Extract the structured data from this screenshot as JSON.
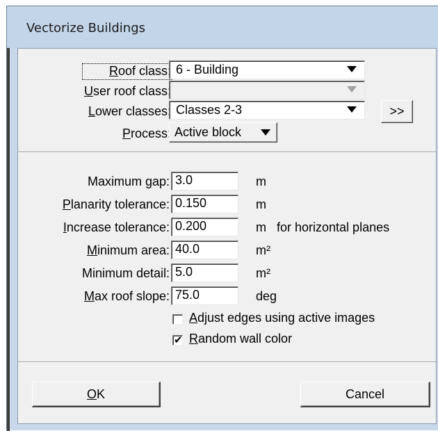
{
  "window": {
    "title": "Vectorize Buildings"
  },
  "classes": {
    "roof_class_label_pre": "",
    "roof_class_label_u": "R",
    "roof_class_label_post": "oof class:",
    "roof_class_value": "6 - Building",
    "user_roof_class_label_u": "U",
    "user_roof_class_label_post": "ser roof class:",
    "user_roof_class_value": "",
    "lower_classes_label_u": "L",
    "lower_classes_label_post": "ower classes:",
    "lower_classes_value": "Classes 2-3",
    "more_button": ">>",
    "process_label_u": "P",
    "process_label_post": "rocess:",
    "process_value": "Active block"
  },
  "params": {
    "max_gap_label": "Maximum gap:",
    "max_gap_value": "3.0",
    "max_gap_unit": "m",
    "planarity_label_u": "P",
    "planarity_label_post": "lanarity tolerance:",
    "planarity_value": "0.150",
    "planarity_unit": "m",
    "increase_label_u": "I",
    "increase_label_post": "ncrease tolerance:",
    "increase_value": "0.200",
    "increase_unit": "m",
    "increase_note": "for horizontal planes",
    "min_area_label_u": "M",
    "min_area_label_post": "inimum area:",
    "min_area_value": "40.0",
    "min_area_unit": "m²",
    "min_detail_label": "Minimum detail:",
    "min_detail_value": "5.0",
    "min_detail_unit": "m²",
    "max_slope_label_u": "M",
    "max_slope_label_post": "ax roof slope:",
    "max_slope_value": "75.0",
    "max_slope_unit": "deg"
  },
  "options": {
    "adjust_edges_label_u": "A",
    "adjust_edges_label_post": "djust edges using active images",
    "adjust_edges_checked": false,
    "random_wall_label_u": "R",
    "random_wall_label_post": "andom wall color",
    "random_wall_checked": true,
    "check_glyph": "✔"
  },
  "buttons": {
    "ok_u": "O",
    "ok_post": "K",
    "cancel": "Cancel"
  }
}
